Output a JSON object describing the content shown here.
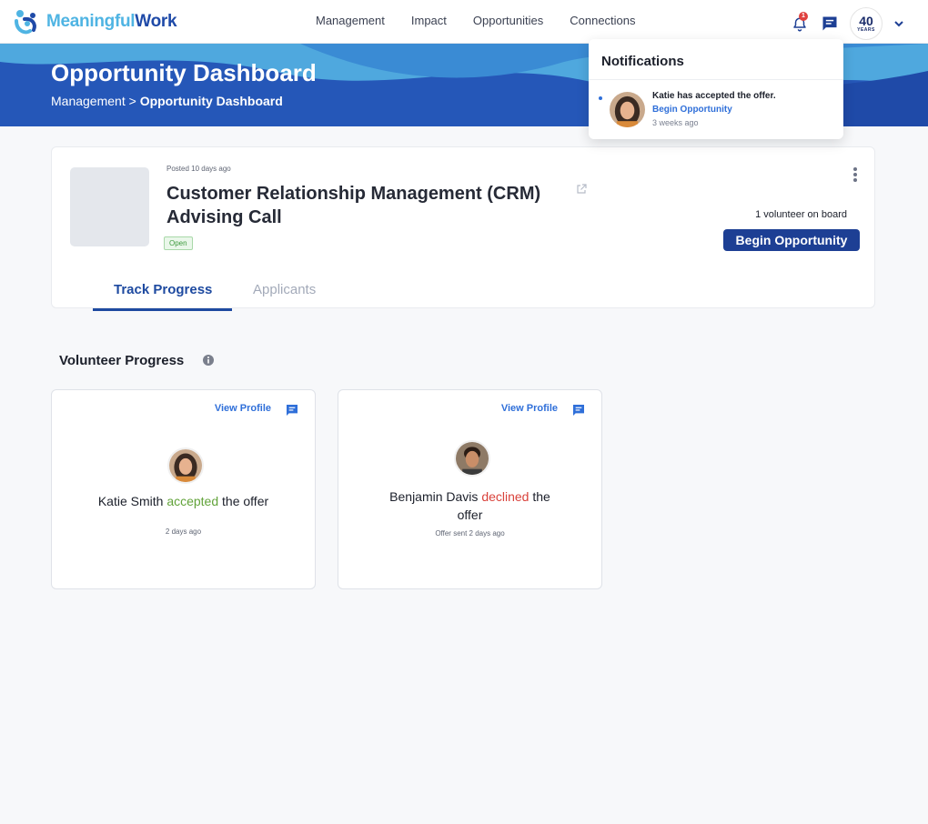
{
  "brand": {
    "part1": "Meaningful",
    "part2": "Work"
  },
  "nav": {
    "links": [
      "Management",
      "Impact",
      "Opportunities",
      "Connections"
    ]
  },
  "header_right": {
    "notification_count": "1",
    "org_logo_number": "40",
    "org_logo_sub": "YEARS"
  },
  "hero": {
    "title": "Opportunity Dashboard",
    "breadcrumb_parent": "Management",
    "breadcrumb_sep": ">",
    "breadcrumb_current": "Opportunity Dashboard"
  },
  "notifications": {
    "title": "Notifications",
    "items": [
      {
        "message": "Katie has accepted the offer.",
        "action": "Begin Opportunity",
        "time": "3 weeks ago"
      }
    ]
  },
  "opportunity": {
    "posted": "Posted 10 days ago",
    "title": "Customer Relationship Management (CRM) Advising Call",
    "status": "Open",
    "volunteers": "1 volunteer on board",
    "begin_label": "Begin Opportunity",
    "tabs": [
      "Track Progress",
      "Applicants"
    ]
  },
  "progress": {
    "title": "Volunteer Progress",
    "cards": [
      {
        "link": "View Profile",
        "name": "Katie Smith",
        "status": "accepted",
        "suffix": "the offer",
        "time": "2 days ago"
      },
      {
        "link": "View Profile",
        "name": "Benjamin Davis",
        "status": "declined",
        "suffix": "the",
        "suffix2": "offer",
        "time": "Offer sent 2 days ago"
      }
    ]
  },
  "colors": {
    "primary": "#1d3f94",
    "accent": "#2f6fd9",
    "hero": "#2557b8",
    "accepted": "#62a33a",
    "declined": "#d9423b"
  }
}
